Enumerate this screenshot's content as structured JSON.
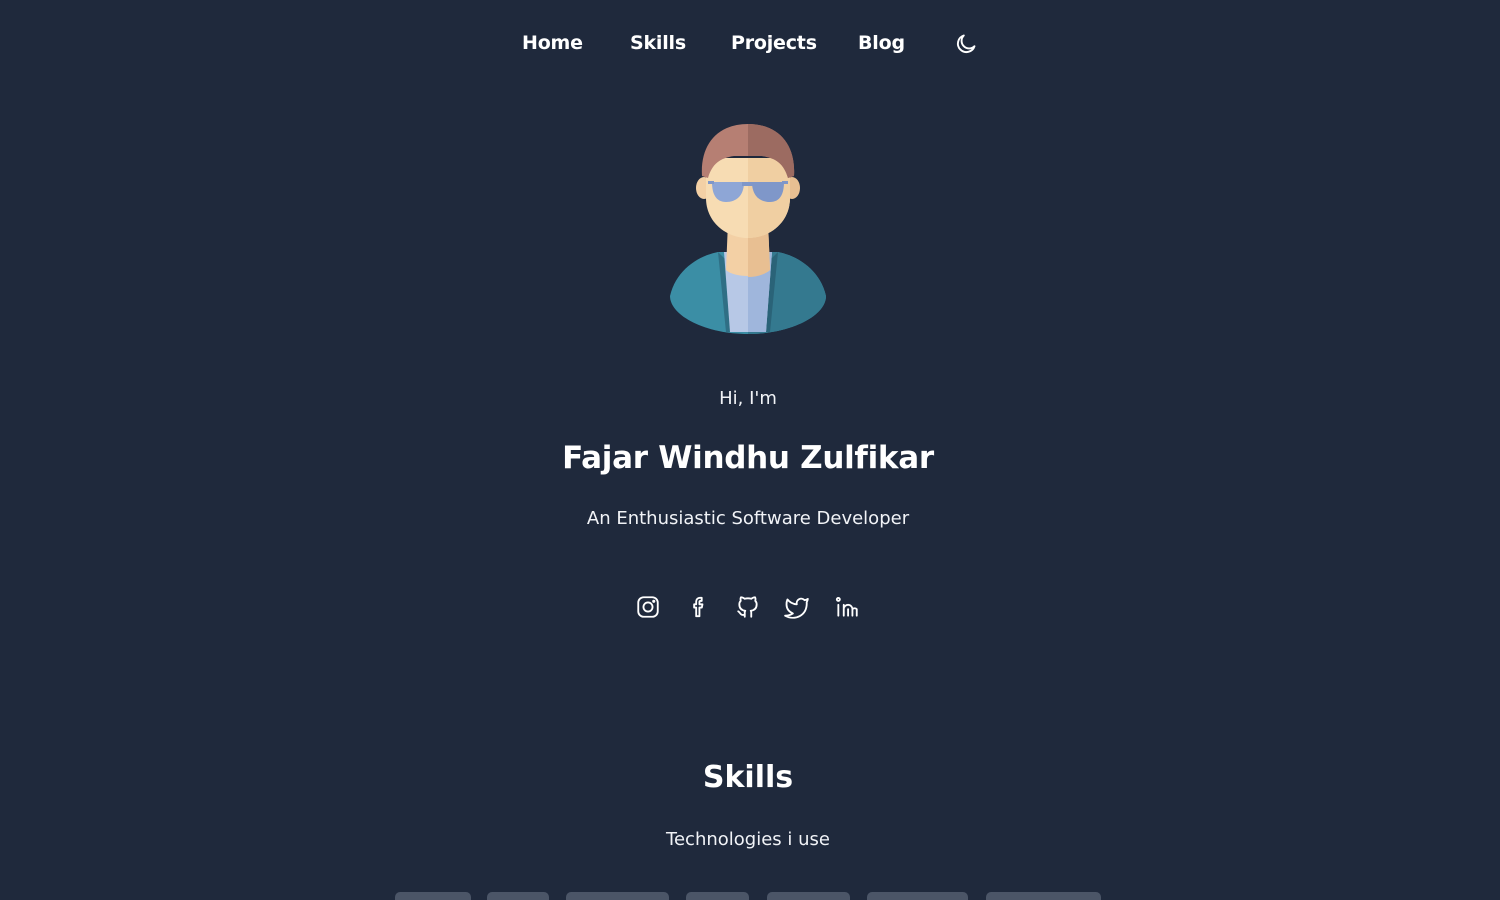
{
  "nav": {
    "items": [
      {
        "label": "Home"
      },
      {
        "label": "Skills"
      },
      {
        "label": "Projects"
      },
      {
        "label": "Blog"
      }
    ],
    "theme_toggle_icon": "moon-icon"
  },
  "hero": {
    "avatar_icon": "developer-avatar-illustration",
    "greeting": "Hi, I'm",
    "name": "Fajar Windhu Zulfikar",
    "tagline": "An Enthusiastic Software Developer"
  },
  "social": [
    {
      "icon": "instagram-icon"
    },
    {
      "icon": "facebook-icon"
    },
    {
      "icon": "github-icon"
    },
    {
      "icon": "twitter-icon"
    },
    {
      "icon": "linkedin-icon"
    }
  ],
  "skills": {
    "title": "Skills",
    "subtitle": "Technologies i use"
  },
  "colors": {
    "background": "#1f293c",
    "text": "#ffffff",
    "chip": "#4b5567"
  }
}
